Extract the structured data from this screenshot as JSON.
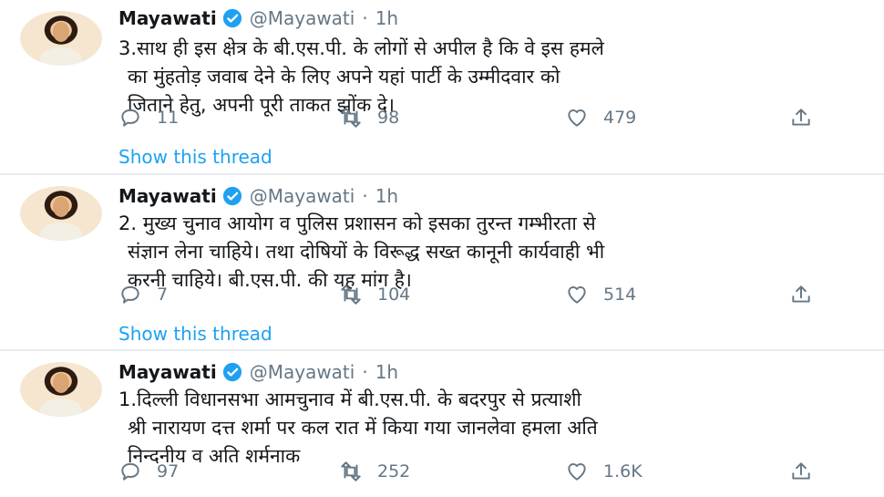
{
  "tweets": [
    {
      "author": "Mayawati",
      "handle": "@Mayawati",
      "dot": "·",
      "time": "1h",
      "lines": [
        "3.साथ ही इस क्षेत्र के बी.एस.पी. के लोगों से अपील है कि वे इस हमले",
        "का मुंहतोड़ जवाब देने के लिए अपने यहां पार्टी के उम्मीदवार को",
        "जिताने हेतु, अपनी पूरी ताकत झोंक दे।"
      ],
      "replies": "11",
      "retweets": "98",
      "likes": "479",
      "show_thread": "Show this thread"
    },
    {
      "author": "Mayawati",
      "handle": "@Mayawati",
      "dot": "·",
      "time": "1h",
      "lines": [
        "2. मुख्य चुनाव आयोग व पुलिस प्रशासन को इसका तुरन्त गम्भीरता से",
        "संज्ञान लेना चाहिये। तथा दोषियों के विरूद्ध सख्त कानूनी कार्यवाही भी",
        "करनी चाहिये। बी.एस.पी. की यह मांग है।"
      ],
      "replies": "7",
      "retweets": "104",
      "likes": "514",
      "show_thread": "Show this thread"
    },
    {
      "author": "Mayawati",
      "handle": "@Mayawati",
      "dot": "·",
      "time": "1h",
      "lines": [
        "1.दिल्ली विधानसभा आमचुनाव में बी.एस.पी. के बदरपुर से प्रत्याशी",
        "श्री नारायण दत्त शर्मा पर कल रात में किया गया जानलेवा हमला अति",
        "निन्दनीय व अति शर्मनाक"
      ],
      "replies": "97",
      "retweets": "252",
      "likes": "1.6K"
    }
  ],
  "icons": {
    "verified": "verified-badge-icon",
    "reply": "reply-icon",
    "retweet": "retweet-icon",
    "like": "like-icon",
    "share": "share-icon"
  },
  "colors": {
    "link": "#1da1f2",
    "secondary": "#657786",
    "divider": "#e6ecf0"
  }
}
